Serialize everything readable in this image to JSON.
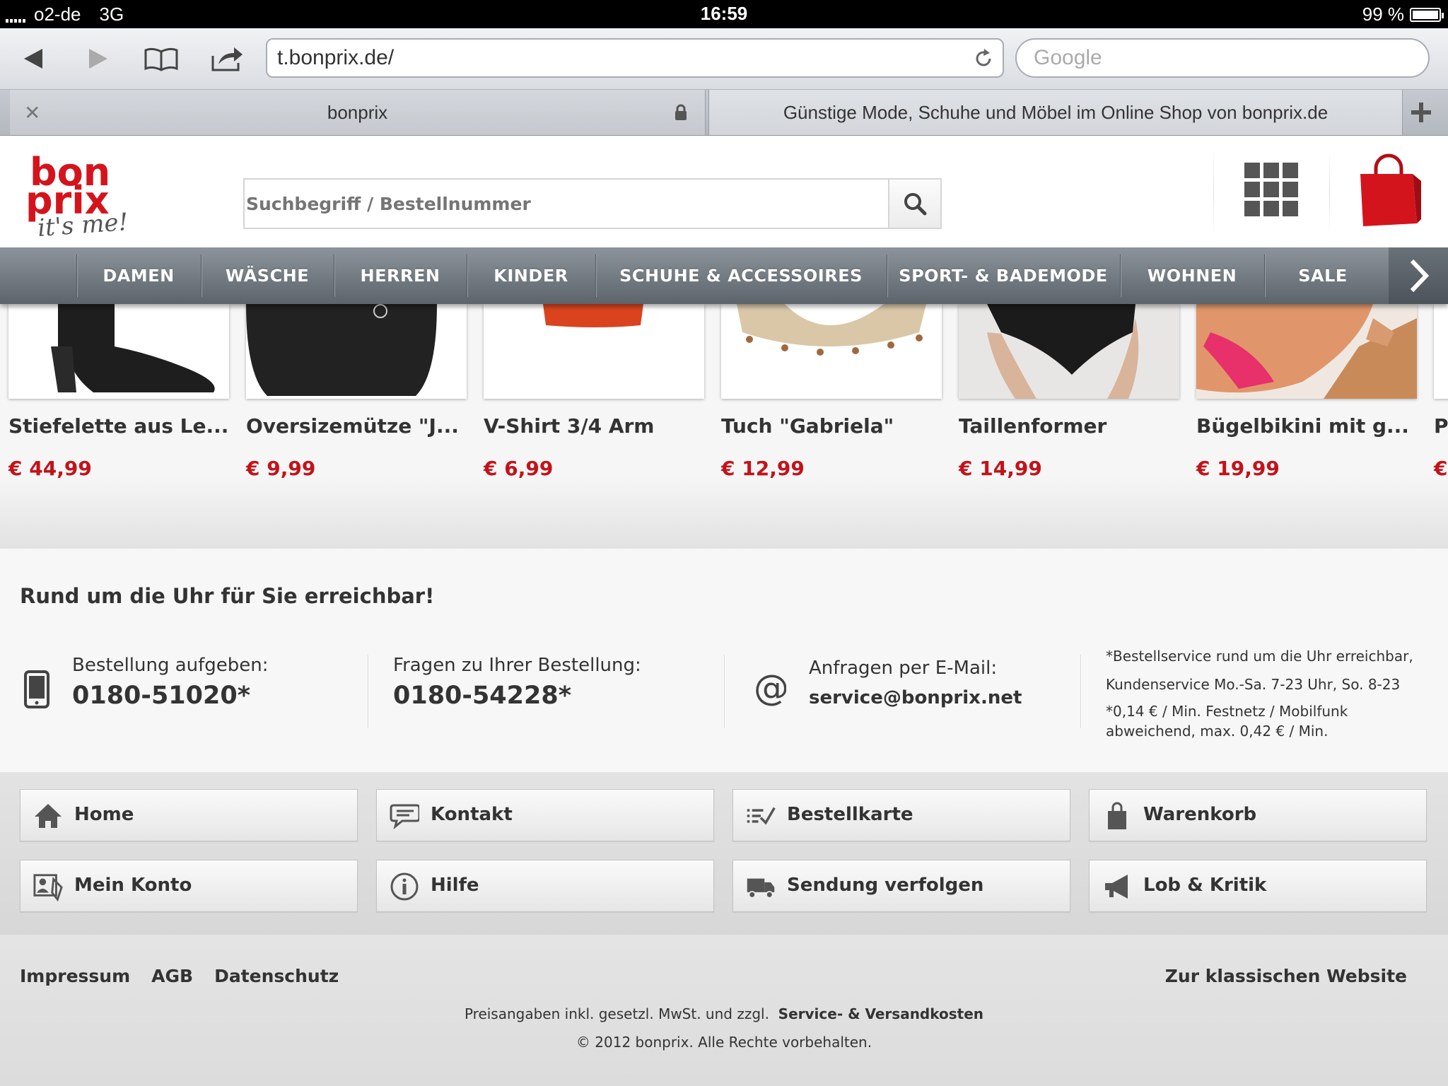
{
  "status_bar": {
    "carrier": "o2-de",
    "network": "3G",
    "time": "16:59",
    "battery": "99 %",
    "battery_level": 0.99
  },
  "browser": {
    "url": "t.bonprix.de/",
    "search_placeholder": "Google",
    "tabs": [
      {
        "title": "bonprix"
      },
      {
        "title": "Günstige Mode, Schuhe und Möbel im Online Shop von bonprix.de"
      }
    ]
  },
  "site": {
    "brand_color": "#d4141c",
    "logo": {
      "line1": "bon",
      "line2": "prix",
      "tagline": "it's me!"
    },
    "search_placeholder": "Suchbegriff / Bestellnummer",
    "nav": [
      "DAMEN",
      "WÄSCHE",
      "HERREN",
      "KINDER",
      "SCHUHE & ACCESSOIRES",
      "SPORT- & BADEMODE",
      "WOHNEN",
      "SALE"
    ],
    "products": [
      {
        "name": "Stiefelette aus Le...",
        "price": "€ 44,99"
      },
      {
        "name": "Oversizemütze \"J...",
        "price": "€ 9,99"
      },
      {
        "name": "V-Shirt 3/4 Arm",
        "price": "€ 6,99"
      },
      {
        "name": "Tuch \"Gabriela\"",
        "price": "€ 12,99"
      },
      {
        "name": "Taillenformer",
        "price": "€ 14,99"
      },
      {
        "name": "Bügelbikini mit g...",
        "price": "€ 19,99"
      },
      {
        "name": "P",
        "price": "€"
      }
    ],
    "service": {
      "headline": "Rund um die Uhr für Sie erreichbar!",
      "order_label": "Bestellung aufgeben:",
      "order_phone": "0180-51020*",
      "questions_label": "Fragen zu Ihrer Bestellung:",
      "questions_phone": "0180-54228*",
      "email_label": "Anfragen per E-Mail:",
      "email": "service@bonprix.net",
      "note1": "*Bestellservice rund um die Uhr erreichbar,",
      "note2": "Kundenservice Mo.-Sa. 7-23 Uhr, So. 8-23",
      "note3": "*0,14 € / Min. Festnetz / Mobilfunk",
      "note4": "abweichend, max. 0,42 € / Min."
    },
    "footer_buttons": [
      {
        "label": "Home",
        "icon": "home-icon"
      },
      {
        "label": "Kontakt",
        "icon": "speech-bubble-icon"
      },
      {
        "label": "Bestellkarte",
        "icon": "checklist-icon"
      },
      {
        "label": "Warenkorb",
        "icon": "shopping-bag-icon"
      },
      {
        "label": "Mein Konto",
        "icon": "account-card-icon"
      },
      {
        "label": "Hilfe",
        "icon": "info-icon"
      },
      {
        "label": "Sendung verfolgen",
        "icon": "truck-icon"
      },
      {
        "label": "Lob & Kritik",
        "icon": "megaphone-icon"
      }
    ],
    "footer_links": [
      "Impressum",
      "AGB",
      "Datenschutz"
    ],
    "classic_link": "Zur klassischen Website",
    "legal_text": "Preisangaben inkl. gesetzl. MwSt. und zzgl.",
    "legal_link": "Service- & Versandkosten",
    "copyright": "© 2012 bonprix. Alle Rechte vorbehalten."
  }
}
